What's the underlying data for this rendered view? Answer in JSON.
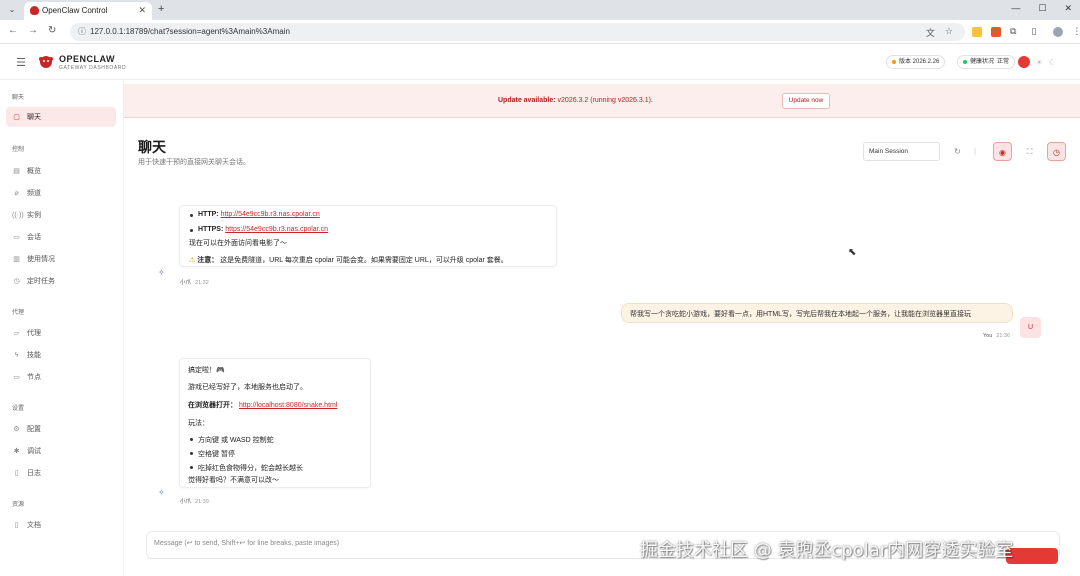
{
  "browser": {
    "tab_title": "OpenClaw Control",
    "url": "127.0.0.1:18789/chat?session=agent%3Amain%3Amain"
  },
  "header": {
    "brand": "OPENCLAW",
    "brand_sub": "GATEWAY DASHBOARD",
    "version_label": "版本 2026.2.26",
    "health_label": "健康状况",
    "health_status": "正常"
  },
  "sidebar": {
    "sections": [
      {
        "title": "聊天",
        "items": [
          {
            "label": "聊天",
            "icon": "chat-icon",
            "active": true
          }
        ]
      },
      {
        "title": "控制",
        "items": [
          {
            "label": "概览",
            "icon": "chart-icon"
          },
          {
            "label": "频道",
            "icon": "link-icon"
          },
          {
            "label": "实例",
            "icon": "broadcast-icon"
          },
          {
            "label": "会话",
            "icon": "doc-icon"
          },
          {
            "label": "使用情况",
            "icon": "bars-icon"
          },
          {
            "label": "定时任务",
            "icon": "clock-icon"
          }
        ]
      },
      {
        "title": "代理",
        "items": [
          {
            "label": "代理",
            "icon": "folder-icon"
          },
          {
            "label": "技能",
            "icon": "bolt-icon"
          },
          {
            "label": "节点",
            "icon": "monitor-icon"
          }
        ]
      },
      {
        "title": "设置",
        "items": [
          {
            "label": "配置",
            "icon": "gear-icon"
          },
          {
            "label": "调试",
            "icon": "bug-icon"
          },
          {
            "label": "日志",
            "icon": "file-icon"
          }
        ]
      },
      {
        "title": "资源",
        "items": [
          {
            "label": "文档",
            "icon": "book-icon"
          }
        ]
      }
    ]
  },
  "banner": {
    "prefix": "Update available:",
    "message": " v2026.3.2 (running v2026.3.1).",
    "button": "Update now"
  },
  "page": {
    "title": "聊天",
    "subtitle": "用于快速干预的直接网关聊天会话。",
    "session": "Main Session"
  },
  "chat": {
    "msg1": {
      "http_label": "HTTP:",
      "http_url": "http://54e9cc9b.r3.nas.cpolar.cn",
      "https_label": "HTTPS:",
      "https_url": "https://54e9cc9b.r3.nas.cpolar.cn",
      "line3": "现在可以在外面访问看电影了～",
      "note_label": "注意：",
      "note": "这是免费隧道，URL 每次重启 cpolar 可能会变。如果需要固定 URL，可以升级 cpolar 套餐。",
      "sender": "小爪",
      "time": "21:32"
    },
    "user_msg": {
      "text": "帮我写一个贪吃蛇小游戏，要好看一点，用HTML写，写完后帮我在本地起一个服务，让我能在浏览器里直接玩",
      "sender": "You",
      "time": "21:36",
      "avatar": "U"
    },
    "msg2": {
      "line1": "搞定啦！🎮",
      "line2": "游戏已经写好了，本地服务也启动了。",
      "open_label": "在浏览器打开：",
      "open_url": "http://localhost:8080/snake.html",
      "play_label": "玩法：",
      "rules": [
        "方向键 或 WASD 控制蛇",
        "空格键 暂停",
        "吃掉红色食物得分，蛇会越长越长"
      ],
      "closing": "觉得好看吗？不满意可以改～",
      "sender": "小爪",
      "time": "21:39"
    }
  },
  "composer": {
    "placeholder": "Message (↩ to send, Shift+↩ for line breaks, paste images)"
  },
  "watermark": "掘金技术社区 @ 袁煦丞cpolar内网穿透实验室",
  "colors": {
    "accent": "#c62828",
    "banner_bg": "#fdeeee",
    "user_bubble": "#fdf3e4"
  }
}
